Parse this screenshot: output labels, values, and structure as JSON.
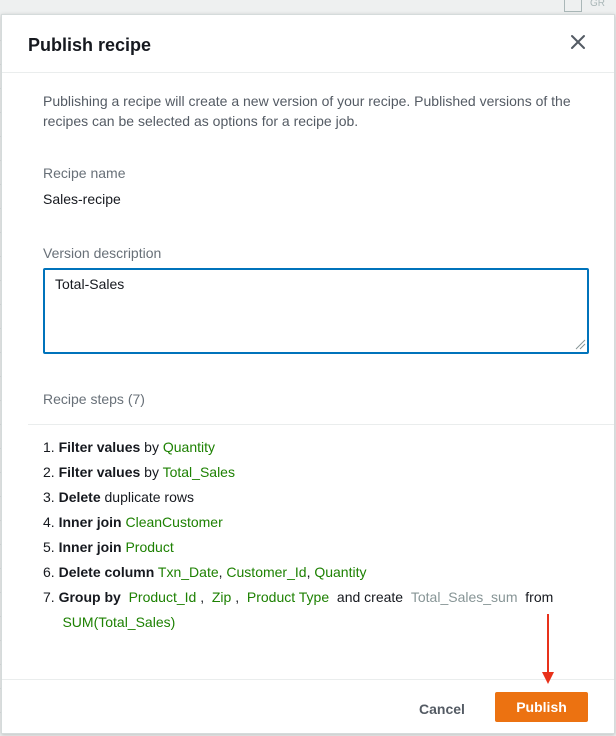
{
  "background": {
    "grid_label": "GR"
  },
  "modal": {
    "title": "Publish recipe",
    "close_icon": "close-icon",
    "intro": "Publishing a recipe will create a new version of your recipe. Published versions of the recipes can be selected as options for a recipe job.",
    "recipe_name_label": "Recipe name",
    "recipe_name_value": "Sales-recipe",
    "version_description_label": "Version description",
    "version_description_value": "Total-Sales",
    "recipe_steps_label": "Recipe steps (7)",
    "steps": [
      {
        "num": "1.",
        "action": "Filter values",
        "text1": " by ",
        "target": "Quantity"
      },
      {
        "num": "2.",
        "action": "Filter values",
        "text1": " by ",
        "target": "Total_Sales"
      },
      {
        "num": "3.",
        "action": "Delete",
        "text1": " duplicate rows"
      },
      {
        "num": "4.",
        "action": "Inner join",
        "text1": " ",
        "target": "CleanCustomer"
      },
      {
        "num": "5.",
        "action": "Inner join",
        "text1": " ",
        "target": "Product"
      },
      {
        "num": "6.",
        "action": "Delete column",
        "col1": "Txn_Date",
        "col2": "Customer_Id",
        "col3": "Quantity"
      },
      {
        "num": "7.",
        "action": "Group by",
        "col1": "Product_Id",
        "col2": "Zip",
        "col3": "Product Type",
        "text_create": "and create",
        "new_col": "Total_Sales_sum",
        "text_from": "from",
        "agg": "SUM(Total_Sales)"
      }
    ],
    "cancel_label": "Cancel",
    "publish_label": "Publish"
  },
  "colors": {
    "accent": "#ec7211",
    "focus_border": "#0073bb",
    "column_green": "#1d8102",
    "annotation_arrow": "#e8311a"
  }
}
